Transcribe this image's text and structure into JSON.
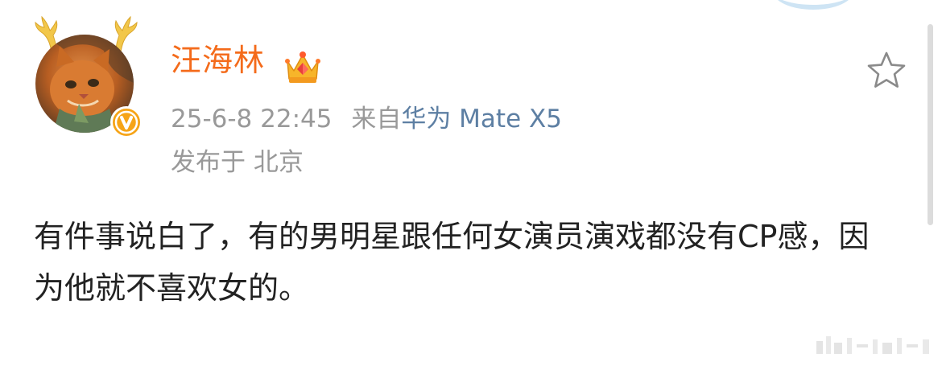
{
  "user": {
    "name": "汪海林"
  },
  "meta": {
    "timestamp": "25-6-8 22:45",
    "source_prefix": "来自",
    "device": "华为 Mate X5"
  },
  "location": "发布于 北京",
  "post": {
    "text": "有件事说白了，有的男明星跟任何女演员演戏都没有CP感，因为他就不喜欢女的。"
  },
  "colors": {
    "username": "#f46b1b",
    "meta_text": "#999999",
    "link": "#5d7fa3",
    "body_text": "#222222",
    "badge": "#f6a417"
  },
  "icons": {
    "crown": "crown-icon",
    "favorite": "star-outline-icon",
    "verified": "verified-v-icon"
  }
}
